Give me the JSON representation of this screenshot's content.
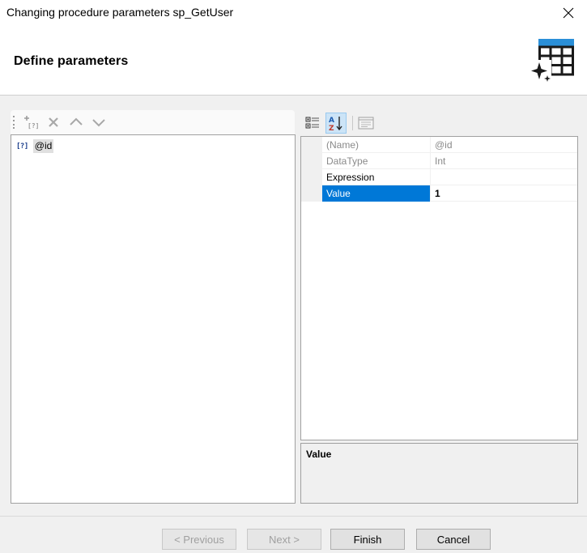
{
  "window": {
    "title": "Changing procedure parameters sp_GetUser"
  },
  "header": {
    "title": "Define parameters",
    "icon": "table-wizard-icon"
  },
  "left_toolbar": {
    "buttons": [
      "add-parameter-icon",
      "delete-icon",
      "move-up-icon",
      "move-down-icon"
    ]
  },
  "parameters": [
    {
      "icon_text": "[?]",
      "name": "@id"
    }
  ],
  "right_toolbar": {
    "buttons": [
      "categorized-icon",
      "alphabetical-icon",
      "property-pages-icon"
    ],
    "active": "alphabetical-icon"
  },
  "properties": [
    {
      "name": "(Name)",
      "value": "@id",
      "readonly": true
    },
    {
      "name": "DataType",
      "value": "Int",
      "readonly": true
    },
    {
      "name": "Expression",
      "value": "",
      "readonly": false
    },
    {
      "name": "Value",
      "value": "1",
      "readonly": false,
      "selected": true
    }
  ],
  "description": {
    "title": "Value"
  },
  "buttons": {
    "previous": "< Previous",
    "next": "Next >",
    "finish": "Finish",
    "cancel": "Cancel"
  },
  "colors": {
    "selection": "#0078d7",
    "param_icon": "#1c3f8c",
    "wizard_icon_header": "#2a8fd8",
    "wizard_icon_grid": "#1a1a1a"
  }
}
